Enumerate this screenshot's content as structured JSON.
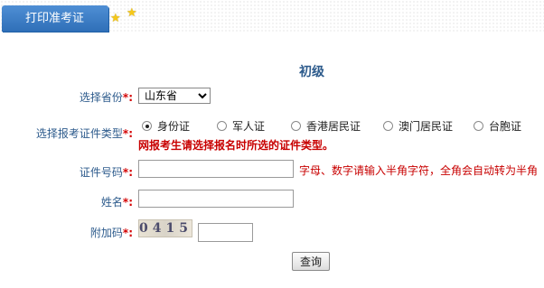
{
  "tab": {
    "label": "打印准考证"
  },
  "title": "初级",
  "form": {
    "province": {
      "label": "选择省份",
      "required_mark": "*:",
      "selected": "山东省"
    },
    "id_type": {
      "label": "选择报考证件类型",
      "required_mark": "*:",
      "options": [
        "身份证",
        "军人证",
        "香港居民证",
        "澳门居民证",
        "台胞证"
      ],
      "selected": "身份证",
      "warning": "网报考生请选择报名时所选的证件类型。"
    },
    "id_number": {
      "label": "证件号码",
      "required_mark": "*:",
      "value": "",
      "hint": "字母、数字请输入半角字符，全角会自动转为半角"
    },
    "name": {
      "label": "姓名",
      "required_mark": "*:",
      "value": ""
    },
    "captcha": {
      "label": "附加码",
      "required_mark": "*:",
      "code": "0415",
      "value": ""
    },
    "submit_label": "查询"
  },
  "colors": {
    "tab": "#3a7cc6",
    "label": "#2d5b8c",
    "required": "#d40000",
    "warning": "#c80000"
  }
}
